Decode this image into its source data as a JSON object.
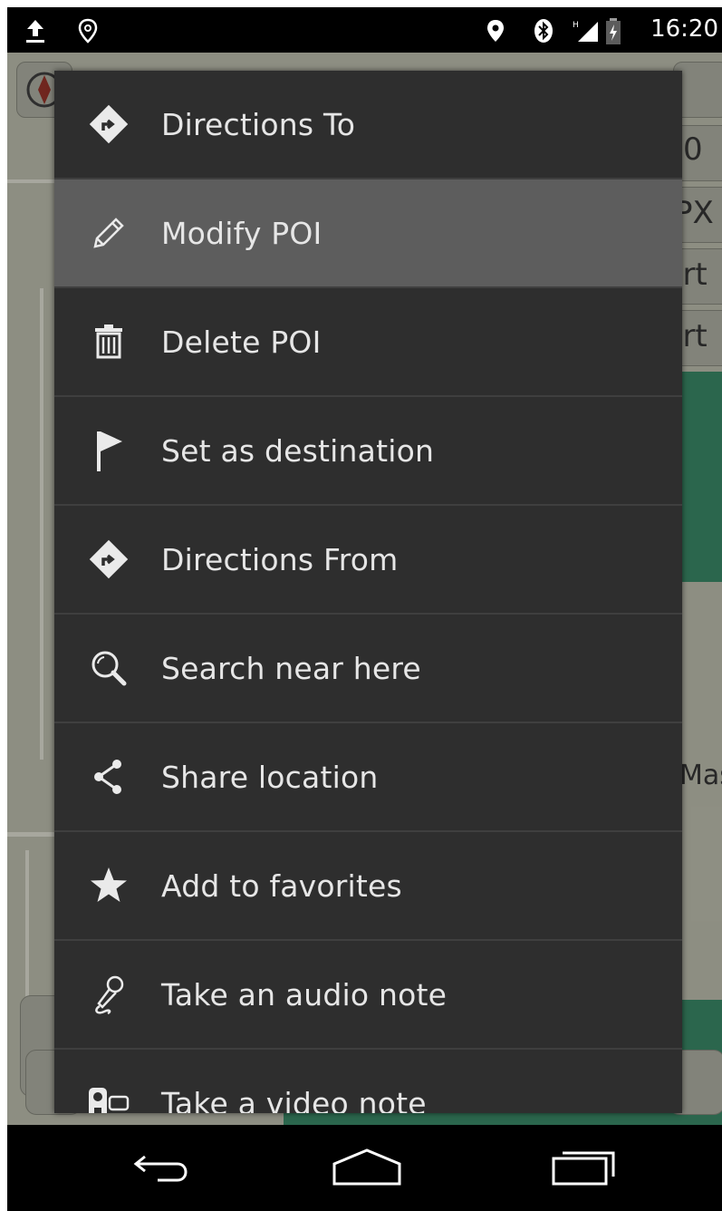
{
  "status_bar": {
    "time": "16:20",
    "icons": [
      "upload-icon",
      "location-outline-icon",
      "location-pin-icon",
      "bluetooth-icon",
      "signal-icon",
      "battery-icon"
    ]
  },
  "map": {
    "side_labels": [
      "0",
      "PX",
      "irt",
      "irt",
      "Mas"
    ]
  },
  "menu": {
    "items": [
      {
        "icon": "directions-icon",
        "label": "Directions To"
      },
      {
        "icon": "pencil-icon",
        "label": "Modify POI"
      },
      {
        "icon": "trash-icon",
        "label": "Delete POI"
      },
      {
        "icon": "flag-icon",
        "label": "Set as destination"
      },
      {
        "icon": "directions-icon",
        "label": "Directions From"
      },
      {
        "icon": "search-icon",
        "label": "Search near here"
      },
      {
        "icon": "share-icon",
        "label": "Share location"
      },
      {
        "icon": "star-icon",
        "label": "Add to favorites"
      },
      {
        "icon": "microphone-icon",
        "label": "Take an audio note"
      },
      {
        "icon": "video-camera-icon",
        "label": "Take a video note"
      }
    ],
    "pressed_index": 1
  },
  "nav_bar": {
    "buttons": [
      "back-icon",
      "home-icon",
      "recent-apps-icon"
    ]
  },
  "colors": {
    "menu_background": "#2e2e2e",
    "menu_pressed": "#5d5d5d",
    "menu_text": "#e6e6e6",
    "map_green": "#2f6f54"
  }
}
